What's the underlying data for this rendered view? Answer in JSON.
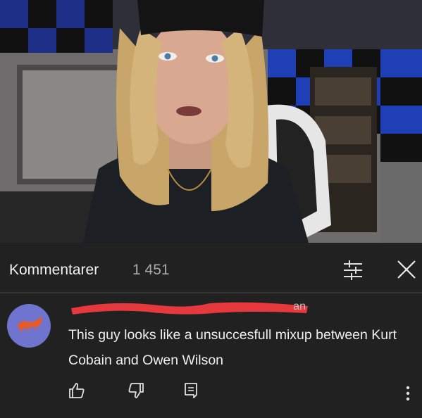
{
  "comments_header": {
    "title": "Kommentarer",
    "count": "1 451"
  },
  "comment": {
    "author_visible": "an",
    "text": "This guy looks like a unsuccesfull mixup between Kurt Cobain and Owen Wilson"
  },
  "icons": {
    "filter": "sliders-icon",
    "close": "close-icon",
    "like": "thumbs-up-icon",
    "dislike": "thumbs-down-icon",
    "reply": "reply-icon",
    "more": "more-vertical-icon"
  },
  "colors": {
    "panel_bg": "#212121",
    "avatar_bg": "#6f75cf",
    "redaction": "#e5393d"
  }
}
